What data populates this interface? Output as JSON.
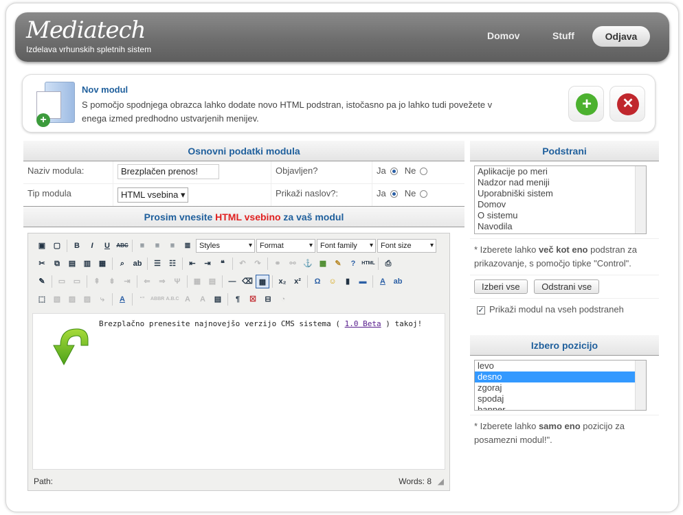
{
  "header": {
    "logo": "Mediatech",
    "tagline": "Izdelava vrhunskih spletnih sistem",
    "nav": [
      "Domov",
      "Stuff"
    ],
    "logout": "Odjava"
  },
  "info": {
    "title": "Nov modul",
    "text": "S pomočjo spodnjega obrazca lahko dodate novo HTML podstran, istočasno pa jo lahko tudi povežete v enega izmed predhodno ustvarjenih menijev."
  },
  "basic": {
    "title": "Osnovni podatki modula",
    "name_label": "Naziv modula:",
    "name_value": "Brezplačen prenos!",
    "published_label": "Objavljen?",
    "type_label": "Tip modula",
    "type_value": "HTML vsebina",
    "show_title_label": "Prikaži naslov?:",
    "yes": "Ja",
    "no": "Ne"
  },
  "editor_title": {
    "prefix": "Prosim vnesite ",
    "highlight": "HTML vsebino",
    "suffix": " za vaš modul"
  },
  "toolbar": {
    "styles": "Styles",
    "format": "Format",
    "font_family": "Font family",
    "font_size": "Font size"
  },
  "editor": {
    "text_before": "Brezplačno prenesite najnovejšo verzijo CMS sistema ( ",
    "link": "1.0 Beta",
    "text_after": " ) takoj!",
    "path_label": "Path:",
    "words": "Words: 8"
  },
  "subpages": {
    "title": "Podstrani",
    "items": [
      "Aplikacije po meri",
      "Nadzor nad meniji",
      "Uporabniški sistem",
      "Domov",
      "O sistemu",
      "Navodila"
    ],
    "note_pre": "* Izberete lahko ",
    "note_bold": "več kot eno",
    "note_post": " podstran za prikazovanje, s pomočjo tipke \"Control\".",
    "select_all": "Izberi vse",
    "remove_all": "Odstrani vse",
    "show_all": "Prikaži modul na vseh podstraneh"
  },
  "position": {
    "title": "Izbero pozicijo",
    "items": [
      "levo",
      "desno",
      "zgoraj",
      "spodaj",
      "banner"
    ],
    "note_pre": "* Izberete lahko ",
    "note_bold": "samo eno",
    "note_post": " pozicijo za posamezni modul!\"."
  },
  "colors": {
    "accent": "#1f5f9c",
    "highlight": "#e02020",
    "selected": "#3399ff"
  }
}
